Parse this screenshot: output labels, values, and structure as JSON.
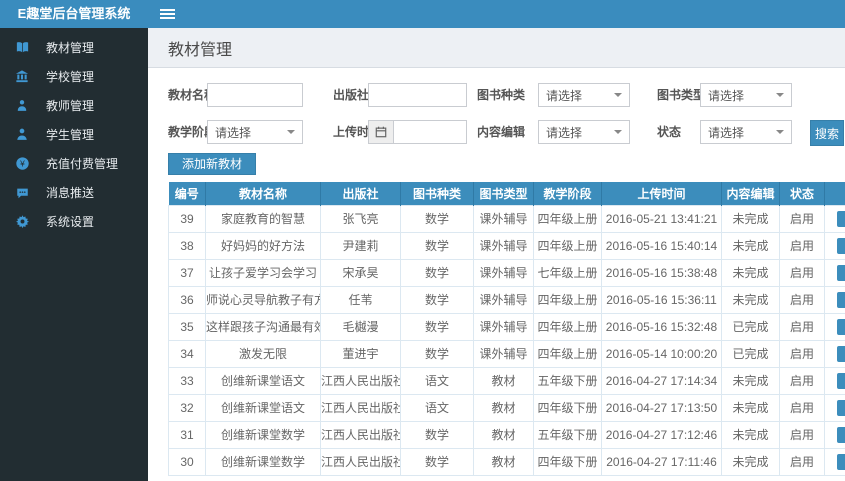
{
  "app": {
    "title": "E趣堂后台管理系统"
  },
  "topbar": {
    "menu_icon": "hamburger-icon"
  },
  "sidebar": {
    "items": [
      {
        "label": "教材管理",
        "icon": "book-icon"
      },
      {
        "label": "学校管理",
        "icon": "school-icon"
      },
      {
        "label": "教师管理",
        "icon": "teacher-icon"
      },
      {
        "label": "学生管理",
        "icon": "student-icon"
      },
      {
        "label": "充值付费管理",
        "icon": "payment-icon"
      },
      {
        "label": "消息推送",
        "icon": "message-icon"
      },
      {
        "label": "系统设置",
        "icon": "settings-icon"
      }
    ]
  },
  "page": {
    "title": "教材管理"
  },
  "search_form": {
    "material_name": {
      "label": "教材名称",
      "value": ""
    },
    "publisher": {
      "label": "出版社",
      "value": ""
    },
    "book_kind": {
      "label": "图书种类",
      "value": "请选择"
    },
    "book_type": {
      "label": "图书类型",
      "value": "请选择"
    },
    "teaching_stage": {
      "label": "教学阶段",
      "value": "请选择"
    },
    "upload_time": {
      "label": "上传时间",
      "value": "",
      "icon": "calendar-icon"
    },
    "content_editor": {
      "label": "内容编辑",
      "value": "请选择"
    },
    "status": {
      "label": "状态",
      "value": "请选择"
    },
    "search_button": "搜索"
  },
  "toolbar": {
    "add_button": "添加新教材"
  },
  "table": {
    "headers": [
      "编号",
      "教材名称",
      "出版社",
      "图书种类",
      "图书类型",
      "教学阶段",
      "上传时间",
      "内容编辑",
      "状态"
    ],
    "action_header": "",
    "rows": [
      [
        "39",
        "家庭教育的智慧",
        "张飞亮",
        "数学",
        "课外辅导",
        "四年级上册",
        "2016-05-21 13:41:21",
        "未完成",
        "启用"
      ],
      [
        "38",
        "好妈妈的好方法",
        "尹建莉",
        "数学",
        "课外辅导",
        "四年级上册",
        "2016-05-16 15:40:14",
        "未完成",
        "启用"
      ],
      [
        "37",
        "让孩子爱学习会学习",
        "宋承昊",
        "数学",
        "课外辅导",
        "七年级上册",
        "2016-05-16 15:38:48",
        "未完成",
        "启用"
      ],
      [
        "36",
        "师说心灵导航教子有方",
        "任苇",
        "数学",
        "课外辅导",
        "四年级上册",
        "2016-05-16 15:36:11",
        "未完成",
        "启用"
      ],
      [
        "35",
        "这样跟孩子沟通最有效",
        "毛樾漫",
        "数学",
        "课外辅导",
        "四年级上册",
        "2016-05-16 15:32:48",
        "已完成",
        "启用"
      ],
      [
        "34",
        "激发无限",
        "董进宇",
        "数学",
        "课外辅导",
        "四年级上册",
        "2016-05-14 10:00:20",
        "已完成",
        "启用"
      ],
      [
        "33",
        "创维新课堂语文",
        "江西人民出版社",
        "语文",
        "教材",
        "五年级下册",
        "2016-04-27 17:14:34",
        "未完成",
        "启用"
      ],
      [
        "32",
        "创维新课堂语文",
        "江西人民出版社",
        "语文",
        "教材",
        "四年级下册",
        "2016-04-27 17:13:50",
        "未完成",
        "启用"
      ],
      [
        "31",
        "创维新课堂数学",
        "江西人民出版社",
        "数学",
        "教材",
        "五年级下册",
        "2016-04-27 17:12:46",
        "未完成",
        "启用"
      ],
      [
        "30",
        "创维新课堂数学",
        "江西人民出版社",
        "数学",
        "教材",
        "四年级下册",
        "2016-04-27 17:11:46",
        "未完成",
        "启用"
      ]
    ]
  },
  "colors": {
    "accent_blue": "#3c8dbc",
    "topbar_blue": "#3a8cbe",
    "sidebar_bg": "#222d32",
    "sidebar_icon": "#4098d3",
    "header_band": "#edf0f4",
    "table_border": "#dce8f1"
  }
}
